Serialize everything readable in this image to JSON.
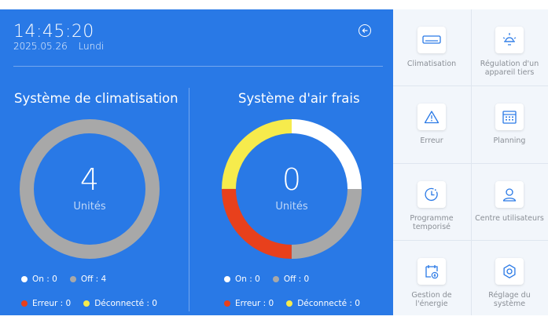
{
  "header": {
    "time": "14:45:20",
    "date": "2025.05.26",
    "weekday": "Lundi"
  },
  "ac_system": {
    "title": "Système de climatisation",
    "count": "4",
    "unit": "Unités",
    "legend": {
      "on": "On : 0",
      "off": "Off : 4",
      "error": "Erreur : 0",
      "disconnected": "Déconnecté : 0"
    },
    "ring": [
      {
        "status": "off",
        "value": 4,
        "color": "#a8a8a8"
      }
    ]
  },
  "fresh_air_system": {
    "title": "Système d'air frais",
    "count": "0",
    "unit": "Unités",
    "legend": {
      "on": "On : 0",
      "off": "Off : 0",
      "error": "Erreur : 0",
      "disconnected": "Déconnecté : 0"
    },
    "ring": [
      {
        "status": "on",
        "value": 1,
        "color": "#ffffff"
      },
      {
        "status": "off",
        "value": 1,
        "color": "#a8a8a8"
      },
      {
        "status": "error",
        "value": 1,
        "color": "#e8401c"
      },
      {
        "status": "disconnected",
        "value": 1,
        "color": "#f6eb4c"
      }
    ]
  },
  "colors": {
    "panel": "#2979e6",
    "on": "#ffffff",
    "off": "#a8a8a8",
    "error": "#e8401c",
    "disconnected": "#f6eb4c"
  },
  "menu": {
    "climatisation": "Climatisation",
    "third_party": "Régulation d'un appareil tiers",
    "error": "Erreur",
    "planning": "Planning",
    "timer": "Programme temporisé",
    "users": "Centre utilisateurs",
    "energy": "Gestion de l'énergie",
    "settings": "Réglage du système"
  }
}
